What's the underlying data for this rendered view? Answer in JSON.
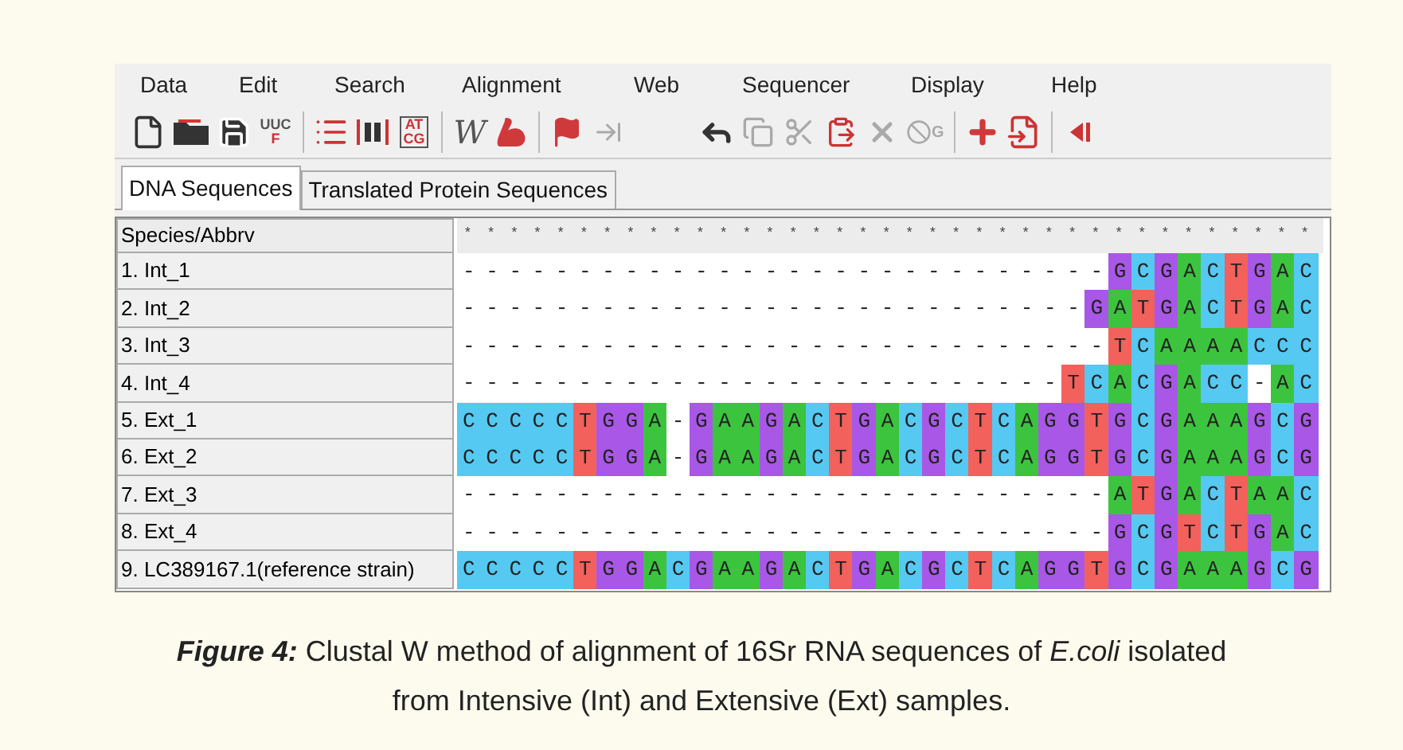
{
  "menu": [
    "Data",
    "Edit",
    "Search",
    "Alignment",
    "Web",
    "Sequencer",
    "Display",
    "Help"
  ],
  "toolbar": [
    {
      "kind": "new",
      "disabled": false,
      "group_end": false
    },
    {
      "kind": "open",
      "disabled": false,
      "group_end": false
    },
    {
      "kind": "save",
      "disabled": false,
      "group_end": false
    },
    {
      "kind": "translate",
      "label": "UUC",
      "sub": "F",
      "disabled": false,
      "group_end": true
    },
    {
      "kind": "list",
      "disabled": false,
      "group_end": false
    },
    {
      "kind": "columns",
      "disabled": false,
      "group_end": false
    },
    {
      "kind": "bases",
      "label": "AT",
      "sub": "CG",
      "disabled": false,
      "group_end": true
    },
    {
      "kind": "letter",
      "label": "W",
      "disabled": false,
      "group_end": false
    },
    {
      "kind": "muscle",
      "disabled": false,
      "group_end": true
    },
    {
      "kind": "flag",
      "disabled": false,
      "group_end": false
    },
    {
      "kind": "arrows",
      "disabled": true,
      "group_end": false
    },
    {
      "kind": "undo",
      "disabled": false,
      "group_end": false
    },
    {
      "kind": "copy",
      "disabled": true,
      "group_end": false
    },
    {
      "kind": "cut",
      "disabled": true,
      "group_end": false
    },
    {
      "kind": "paste",
      "disabled": false,
      "group_end": false
    },
    {
      "kind": "delete",
      "disabled": true,
      "group_end": false
    },
    {
      "kind": "nogap",
      "label": "G",
      "disabled": true,
      "group_end": true
    },
    {
      "kind": "add",
      "disabled": false,
      "group_end": false
    },
    {
      "kind": "import",
      "disabled": false,
      "group_end": true
    },
    {
      "kind": "back",
      "disabled": false,
      "group_end": false
    }
  ],
  "tabs": [
    {
      "label": "DNA Sequences",
      "selected": true
    },
    {
      "label": "Translated Protein Sequences",
      "selected": false
    }
  ],
  "table": {
    "header": "Species/Abbrv",
    "consensus": "*************************************",
    "rows": [
      {
        "name": "1. Int_1",
        "sequence": "----------------------------GCGACTGAC"
      },
      {
        "name": "2. Int_2",
        "sequence": "---------------------------GATGACTGAC"
      },
      {
        "name": "3. Int_3",
        "sequence": "----------------------------TCAAAACCC"
      },
      {
        "name": "4. Int_4",
        "sequence": "--------------------------TCACGACC-AC"
      },
      {
        "name": "5. Ext_1",
        "sequence": "CCCCCTGGA-GAAGACTGACGCTCAGGTGCGAAAGCG"
      },
      {
        "name": "6. Ext_2",
        "sequence": "CCCCCTGGA-GAAGACTGACGCTCAGGTGCGAAAGCG"
      },
      {
        "name": "7. Ext_3",
        "sequence": "----------------------------ATGACTAAC"
      },
      {
        "name": "8. Ext_4",
        "sequence": "----------------------------GCGTCTGAC"
      },
      {
        "name": "9. LC389167.1(reference strain)",
        "sequence": "CCCCCTGGACGAAGACTGACGCTCAGGTGCGAAAGCG"
      }
    ]
  },
  "caption": {
    "label": "Figure 4:",
    "lines": [
      "Clustal W method of alignment of 16Sr RNA sequences of *E.coli* isolated",
      "from Intensive (Int) and Extensive (Ext) samples."
    ]
  }
}
